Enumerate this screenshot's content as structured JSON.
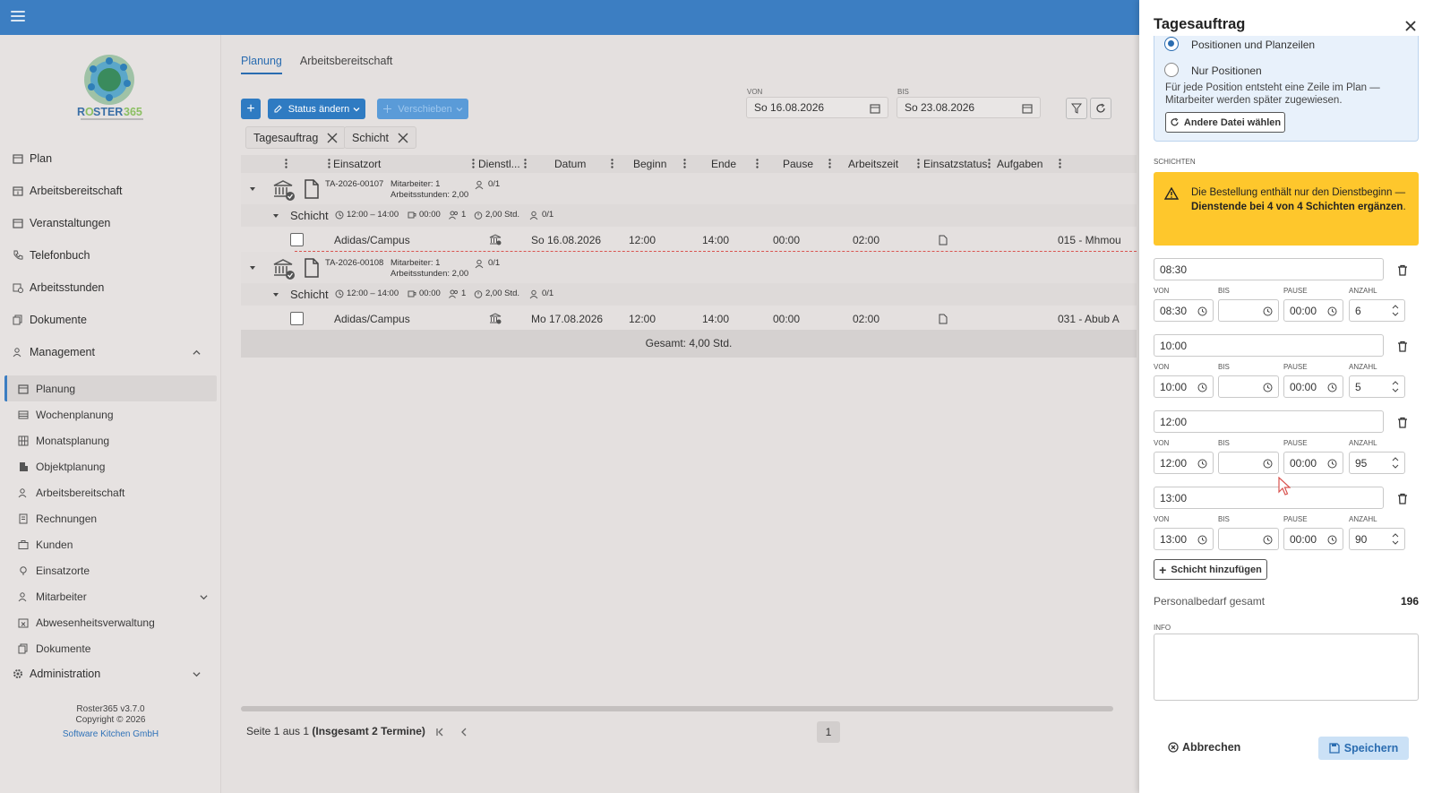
{
  "sidebar": {
    "nav": [
      {
        "label": "Plan",
        "icon": "calendar-icon"
      },
      {
        "label": "Arbeitsbereitschaft",
        "icon": "calendar-plus-icon"
      },
      {
        "label": "Veranstaltungen",
        "icon": "calendar-plus-icon"
      },
      {
        "label": "Telefonbuch",
        "icon": "phone-book-icon"
      },
      {
        "label": "Arbeitsstunden",
        "icon": "calendar-clock-icon"
      },
      {
        "label": "Dokumente",
        "icon": "documents-icon"
      },
      {
        "label": "Management",
        "icon": "users-icon"
      }
    ],
    "sub": [
      {
        "label": "Planung",
        "icon": "calendar-icon"
      },
      {
        "label": "Wochenplanung",
        "icon": "table-icon"
      },
      {
        "label": "Monatsplanung",
        "icon": "grid-icon"
      },
      {
        "label": "Objektplanung",
        "icon": "building-icon"
      },
      {
        "label": "Arbeitsbereitschaft",
        "icon": "user-check-icon"
      },
      {
        "label": "Rechnungen",
        "icon": "invoice-icon"
      },
      {
        "label": "Kunden",
        "icon": "briefcase-icon"
      },
      {
        "label": "Einsatzorte",
        "icon": "location-icon"
      },
      {
        "label": "Mitarbeiter",
        "icon": "users-icon"
      },
      {
        "label": "Abwesenheitsverwaltung",
        "icon": "calendar-x-icon"
      },
      {
        "label": "Dokumente",
        "icon": "documents-icon"
      }
    ],
    "admin": "Administration",
    "footer": {
      "version": "Roster365 v3.7.0",
      "copyright": "Copyright © 2026",
      "company": "Software Kitchen GmbH"
    }
  },
  "main": {
    "tabs": [
      "Planung",
      "Arbeitsbereitschaft"
    ],
    "toolbar": {
      "add": "+",
      "status": "Status ändern",
      "move": "Verschieben"
    },
    "date_from": {
      "label": "VON",
      "value": "So 16.08.2026"
    },
    "date_to": {
      "label": "BIS",
      "value": "So 23.08.2026"
    },
    "chips": [
      "Tagesauftrag",
      "Schicht"
    ],
    "columns": [
      "Einsatzort",
      "Dienstl...",
      "Datum",
      "Beginn",
      "Ende",
      "Pause",
      "Arbeitszeit",
      "Einsatzstatus",
      "Aufgaben"
    ],
    "groups": [
      {
        "id": "TA-2026-00107",
        "mitarbeiter": "Mitarbeiter: 1",
        "stunden": "Arbeitsstunden: 2,00",
        "count": "0/1",
        "shift": {
          "label": "Schicht",
          "time": "12:00 – 14:00",
          "pause": "00:00",
          "people": "1",
          "hours": "2,00 Std.",
          "count": "0/1"
        },
        "row": {
          "ort": "Adidas/Campus",
          "datum": "So 16.08.2026",
          "beginn": "12:00",
          "ende": "14:00",
          "pause": "00:00",
          "arbeitszeit": "02:00",
          "aufgabe": "015 - Mhmou"
        }
      },
      {
        "id": "TA-2026-00108",
        "mitarbeiter": "Mitarbeiter: 1",
        "stunden": "Arbeitsstunden: 2,00",
        "count": "0/1",
        "shift": {
          "label": "Schicht",
          "time": "12:00 – 14:00",
          "pause": "00:00",
          "people": "1",
          "hours": "2,00 Std.",
          "count": "0/1"
        },
        "row": {
          "ort": "Adidas/Campus",
          "datum": "Mo 17.08.2026",
          "beginn": "12:00",
          "ende": "14:00",
          "pause": "00:00",
          "arbeitszeit": "02:00",
          "aufgabe": "031 - Abub A"
        }
      }
    ],
    "total": "Gesamt: 4,00 Std.",
    "pager": {
      "text": "Seite 1 aus 1 ",
      "bold": "(Insgesamt 2 Termine)",
      "page": "1"
    }
  },
  "panel": {
    "title": "Tagesauftrag",
    "radio1": "Positionen und Planzeilen",
    "radio2": "Nur Positionen",
    "hint": "Für jede Position entsteht eine Zeile im Plan — Mitarbeiter werden später zugewiesen.",
    "choose_file": "Andere Datei wählen",
    "shifts_label": "SCHICHTEN",
    "warn_pre": "Die Bestellung enthält nur den Dienstbeginn — ",
    "warn_bold": "Dienstende bei 4 von 4 Schichten ergänzen",
    "warn_post": ".",
    "labels": {
      "von": "VON",
      "bis": "BIS",
      "pause": "PAUSE",
      "anzahl": "ANZAHL"
    },
    "shifts": [
      {
        "name": "08:30",
        "von": "08:30",
        "bis": "",
        "pause": "00:00",
        "anzahl": "6"
      },
      {
        "name": "10:00",
        "von": "10:00",
        "bis": "",
        "pause": "00:00",
        "anzahl": "5"
      },
      {
        "name": "12:00",
        "von": "12:00",
        "bis": "",
        "pause": "00:00",
        "anzahl": "95"
      },
      {
        "name": "13:00",
        "von": "13:00",
        "bis": "",
        "pause": "00:00",
        "anzahl": "90"
      }
    ],
    "add_shift": "Schicht hinzufügen",
    "staff_label": "Personalbedarf gesamt",
    "staff_total": "196",
    "info_label": "INFO",
    "cancel": "Abbrechen",
    "save": "Speichern"
  }
}
